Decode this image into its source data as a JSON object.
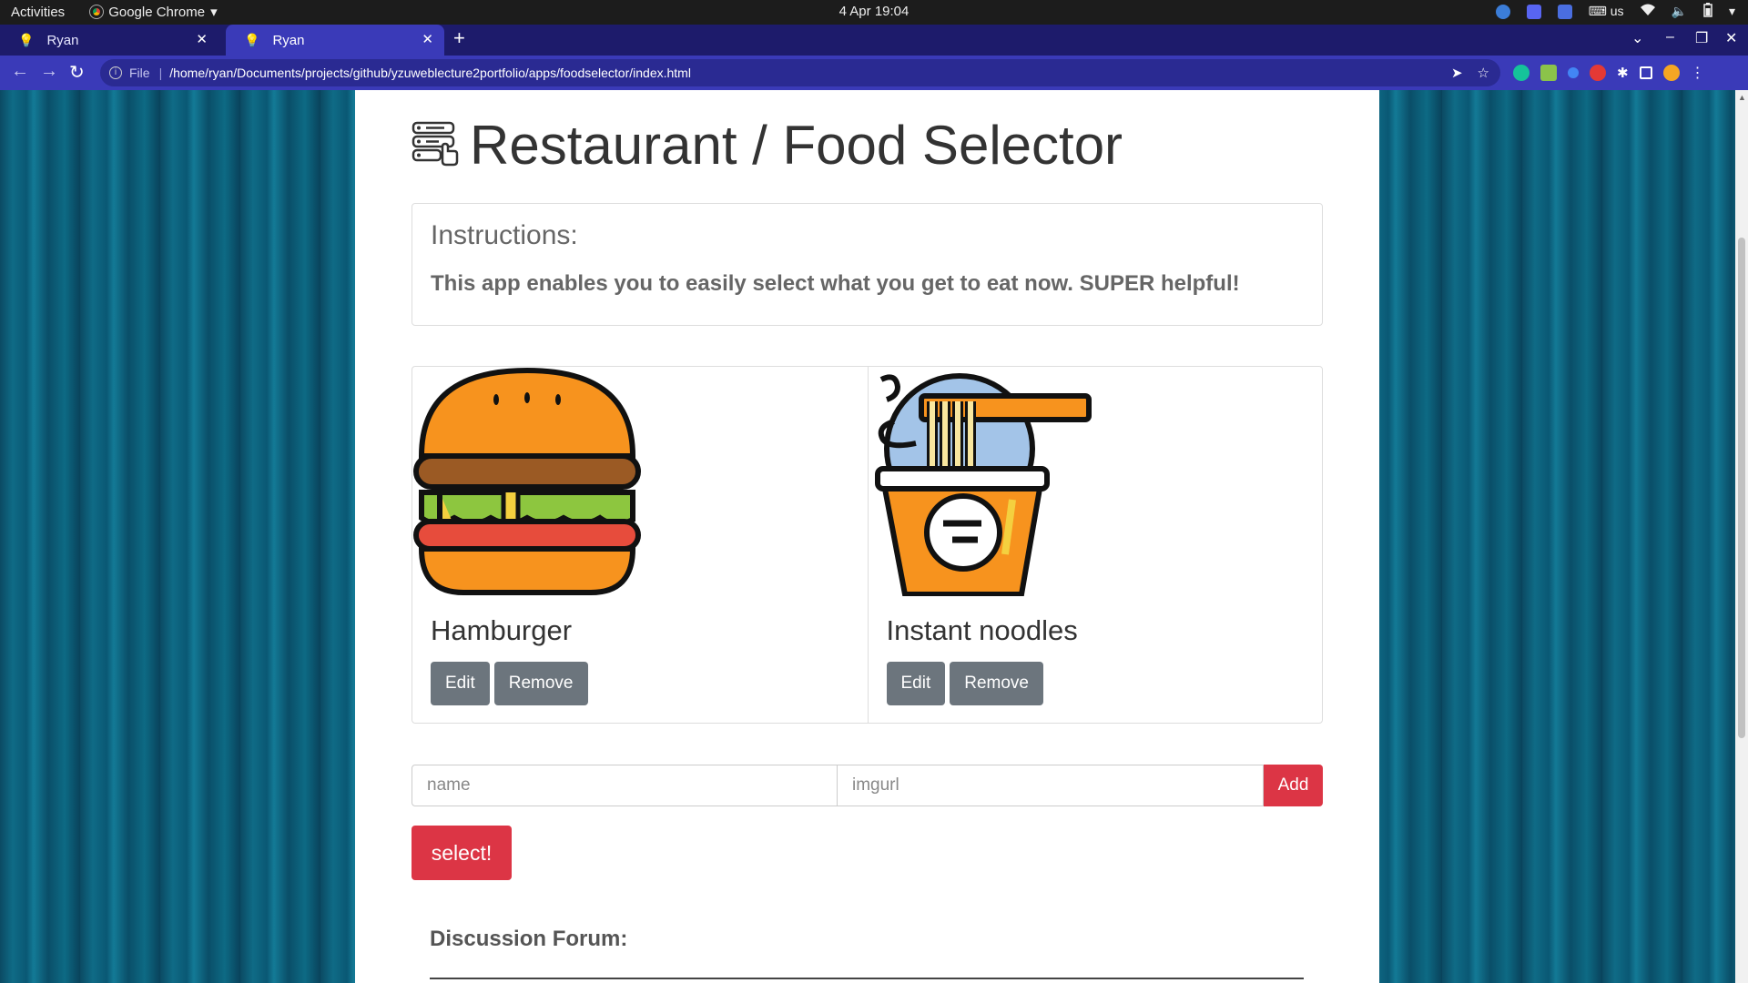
{
  "topbar": {
    "activities": "Activities",
    "app_name": "Google Chrome",
    "clock": "4 Apr  19:04",
    "keyboard": "us"
  },
  "tabs": [
    {
      "label": "Ryan",
      "active": false
    },
    {
      "label": "Ryan",
      "active": true
    }
  ],
  "address_bar": {
    "scheme_label": "File",
    "url": "/home/ryan/Documents/projects/github/yzuweblecture2portfolio/apps/foodselector/index.html"
  },
  "page": {
    "title": "Restaurant / Food Selector",
    "instructions_heading": "Instructions:",
    "instructions_body": "This app enables you to easily select what you get to eat now. SUPER helpful!",
    "foods": [
      {
        "name": "Hamburger",
        "icon": "hamburger-icon",
        "edit_label": "Edit",
        "remove_label": "Remove"
      },
      {
        "name": "Instant noodles",
        "icon": "instant-noodles-icon",
        "edit_label": "Edit",
        "remove_label": "Remove"
      }
    ],
    "form": {
      "name_placeholder": "name",
      "imgurl_placeholder": "imgurl",
      "add_label": "Add"
    },
    "select_label": "select!",
    "forum_heading": "Discussion Forum:"
  },
  "colors": {
    "danger": "#dc3545",
    "secondary": "#6c757d",
    "chrome_frame": "#1d1b6b",
    "chrome_toolbar": "#3a3ab8"
  }
}
